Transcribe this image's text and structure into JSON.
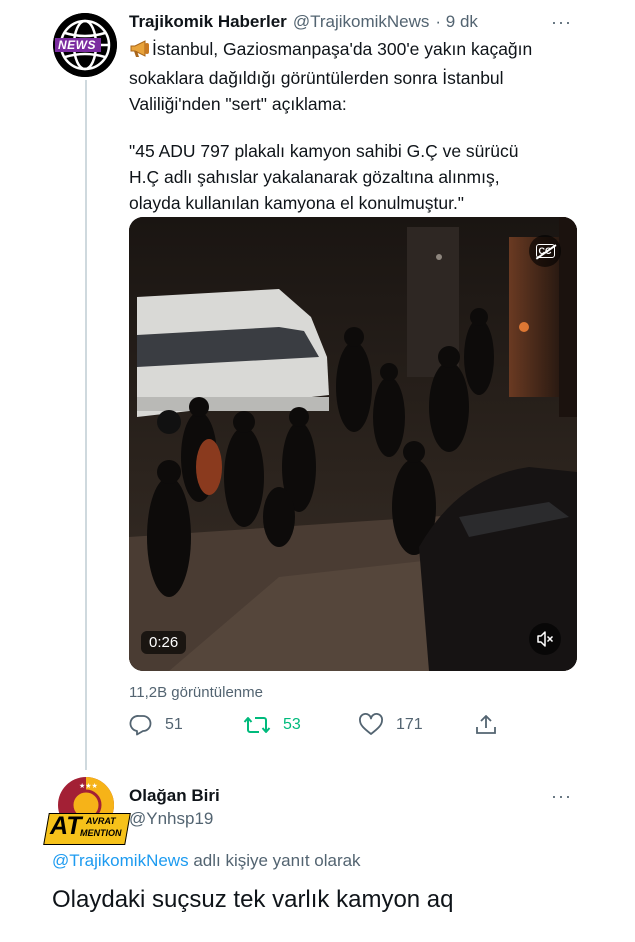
{
  "tweet": {
    "author": {
      "name": "Trajikomik Haberler",
      "handle": "@TrajikomikNews",
      "time": "· 9 dk",
      "avatar_label": "NEWS"
    },
    "more_label": "···",
    "text_lines": [
      "İstanbul, Gaziosmanpaşa'da 300'e yakın kaçağın",
      "sokaklara dağıldığı görüntülerden sonra İstanbul",
      "Valiliği'nden \"sert\" açıklama:"
    ],
    "quote_lines": [
      "\"45 ADU 797 plakalı kamyon sahibi G.Ç ve sürücü",
      "H.Ç adlı şahıslar yakalanarak gözaltına alınmış,",
      "olayda kullanılan kamyona el konulmuştur.\""
    ],
    "video": {
      "duration": "0:26",
      "cc_label": "CC"
    },
    "views": "11,2B görüntülenme",
    "actions": {
      "reply_count": "51",
      "retweet_count": "53",
      "like_count": "171"
    },
    "colors": {
      "retweet": "#00ba7c",
      "link": "#1d9bf0",
      "muted": "#536471"
    }
  },
  "reply": {
    "author": {
      "name": "Olağan Biri",
      "handle": "@Ynhsp19",
      "avatar_text_1": "AT",
      "avatar_text_2": "AVRAT",
      "avatar_text_3": "MENTION"
    },
    "more_label": "···",
    "replying_to_handle": "@TrajikomikNews",
    "replying_to_suffix": " adlı kişiye yanıt olarak",
    "text": "Olaydaki suçsuz tek varlık kamyon aq"
  }
}
